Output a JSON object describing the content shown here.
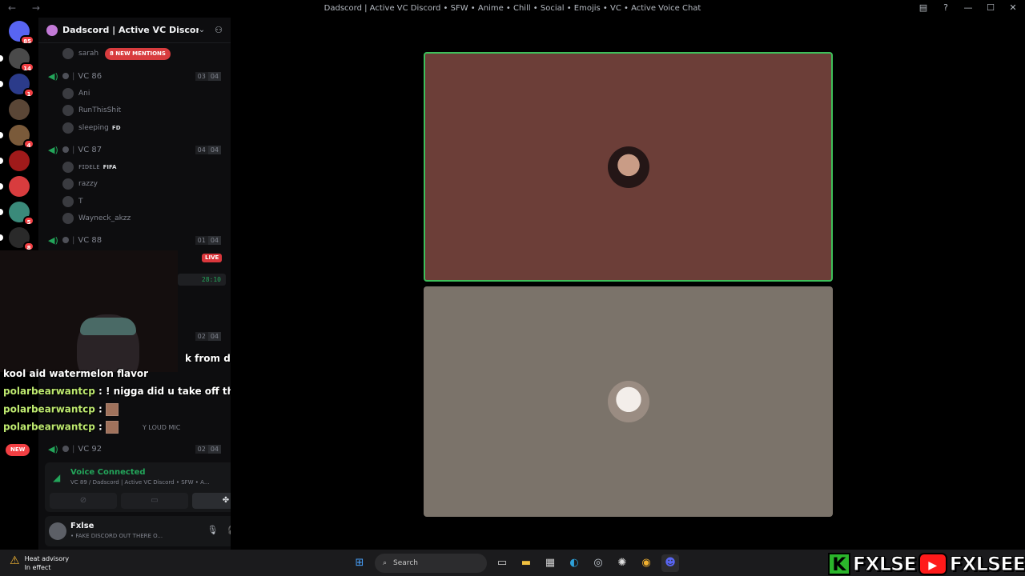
{
  "window": {
    "title": "Dadscord | Active VC Discord • SFW • Anime • Chill • Social • Emojis • VC • Active Voice Chat",
    "nav_arrows": "← →"
  },
  "servers": [
    {
      "badge": "85",
      "color": "#5865f2"
    },
    {
      "badge": "14",
      "color": "#4a4a4a"
    },
    {
      "badge": "1",
      "color": "#2b3b8a"
    },
    {
      "badge": "",
      "color": "#5a4636"
    },
    {
      "badge": "4",
      "color": "#7a5a3a"
    },
    {
      "badge": "",
      "color": "#a01a1a"
    },
    {
      "badge": "",
      "color": "#d83c3e"
    },
    {
      "badge": "5",
      "color": "#3a8a7a"
    },
    {
      "badge": "8",
      "color": "#2a2a2a"
    }
  ],
  "guild": {
    "name": "Dadscord | Active VC Discord • SF...",
    "chevron": "⌄",
    "invite_icon": "⚇"
  },
  "channel_list": {
    "mentions_badge": "8 NEW MENTIONS",
    "top_member": "sarah",
    "vc86": {
      "name": "VC 86",
      "count": "03",
      "limit": "04",
      "members": [
        "Ani",
        "RunThisShit",
        "sleeping"
      ],
      "member_tag": "FD"
    },
    "vc87": {
      "name": "VC 87",
      "count": "04",
      "limit": "04",
      "members": [
        "ꜰɪᴅᴇʟᴇ",
        "razzy",
        "T",
        "Wayneck_akzz"
      ],
      "member_tag": "FIFA"
    },
    "vc88": {
      "name": "VC 88",
      "count": "01",
      "limit": "04"
    },
    "hidden_count": "02",
    "hidden_limit": "04",
    "vc92": {
      "name": "VC 92",
      "count": "02",
      "limit": "04"
    },
    "loud_mic_label": "Y LOUD MIC",
    "live_label": "LIVE",
    "timer": "28:10",
    "new_badge": "NEW"
  },
  "chat_overlay": [
    {
      "user": "",
      "text": "k from dat diet doctor pepper to get sum"
    },
    {
      "user": "",
      "text": "kool aid watermelon flavor"
    },
    {
      "user": "polarbearwantcp",
      "text": " : ! nigga did u take off the sticker? or does it come like that"
    },
    {
      "user": "polarbearwantcp",
      "text": " : "
    },
    {
      "user": "polarbearwantcp",
      "text": " : "
    }
  ],
  "voice": {
    "status": "Voice Connected",
    "channel": "VC 89 / Dadscord | Active VC Discord • SFW • A...",
    "buttons": [
      "⊘",
      "▭",
      "✤"
    ]
  },
  "user": {
    "name": "Fxlse",
    "status": "• FAKE DISCORD OUT THERE O..."
  },
  "taskbar": {
    "weather_title": "Heat advisory",
    "weather_sub": "In effect",
    "search_placeholder": "Search"
  },
  "brand_overlay": {
    "k_letter": "K",
    "name1": "FXLSE",
    "name2": "FXLSEE"
  },
  "colors": {
    "speaking_border": "#3dbf5a",
    "tile1_bg": "#6c3e38",
    "tile2_bg": "#7b736a",
    "accent_green": "#23a55a",
    "mention_red": "#d83c3e"
  }
}
